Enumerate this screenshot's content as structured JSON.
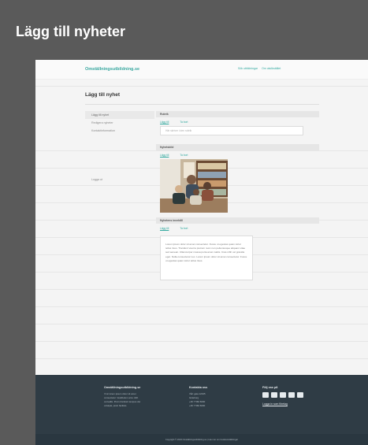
{
  "page": {
    "title": "Lägg till nyheter"
  },
  "site": {
    "logo": "Omställningsutbildning.se",
    "header_links": [
      "Sök utbildningar",
      "Om utsökstället"
    ]
  },
  "main": {
    "title": "Lägg till nyhet",
    "menu": [
      "Lägg till nyhet",
      "Redigera nyheter",
      "Kontaktinformation"
    ],
    "logout": "Logga ut"
  },
  "form": {
    "rubrik": {
      "label": "Rubrik",
      "tabs": [
        "Lägg till",
        "Ta bort"
      ],
      "placeholder": "Här skriver i den rubrik"
    },
    "nyhetsbild": {
      "label": "Nyhetsbild",
      "tabs": [
        "Lägg till",
        "Ta bort"
      ]
    },
    "innehall": {
      "label": "Nyhetens innehåll",
      "tabs": [
        "Lägg till",
        "Ta bort"
      ],
      "text": "Lorem ipsum dolor sit amet consectetur. Fusce ut egestas quam tortor tellus risus. Tincidunt viverra pretium nunc non pellentesque aliquam vitae sed aenean. Ullamcorper massa porta amet mattis. Cras nibh vel gravida eget. Nulla consectetur nec. Lorem ipsum dolor sit amet consectetur. Fusce ut egestas quam tortor tellus risus."
    }
  },
  "footer": {
    "col1": {
      "heading": "Omställningsutbildning.se",
      "lines": [
        "Vi är lorem ipsum dolor sit amet",
        "consectetur. Vestibulum arcu nibh",
        "convallis. Proin tincidunt tempus dui",
        "volutpat, proin facilisis."
      ]
    },
    "col2": {
      "heading": "Kontakta oss",
      "lines": [
        "Vårt gata 12345",
        "Göteborg",
        "+46 7 560 6000",
        "+46 7 560 6000"
      ]
    },
    "col3": {
      "heading": "Följ oss på",
      "social_icons": [
        "facebook-icon",
        "instagram-icon",
        "linkedin-icon",
        "twitter-icon",
        "youtube-icon"
      ],
      "link": "Logga in som företag"
    },
    "copyright": "Copyright © 2023 Omställningsutbildning.se   |   Läs mer om Cookieinställningar"
  },
  "colors": {
    "accent": "#2fa89e",
    "footer_bg": "#2f3c45",
    "outer_bg": "#5a5a5a"
  }
}
